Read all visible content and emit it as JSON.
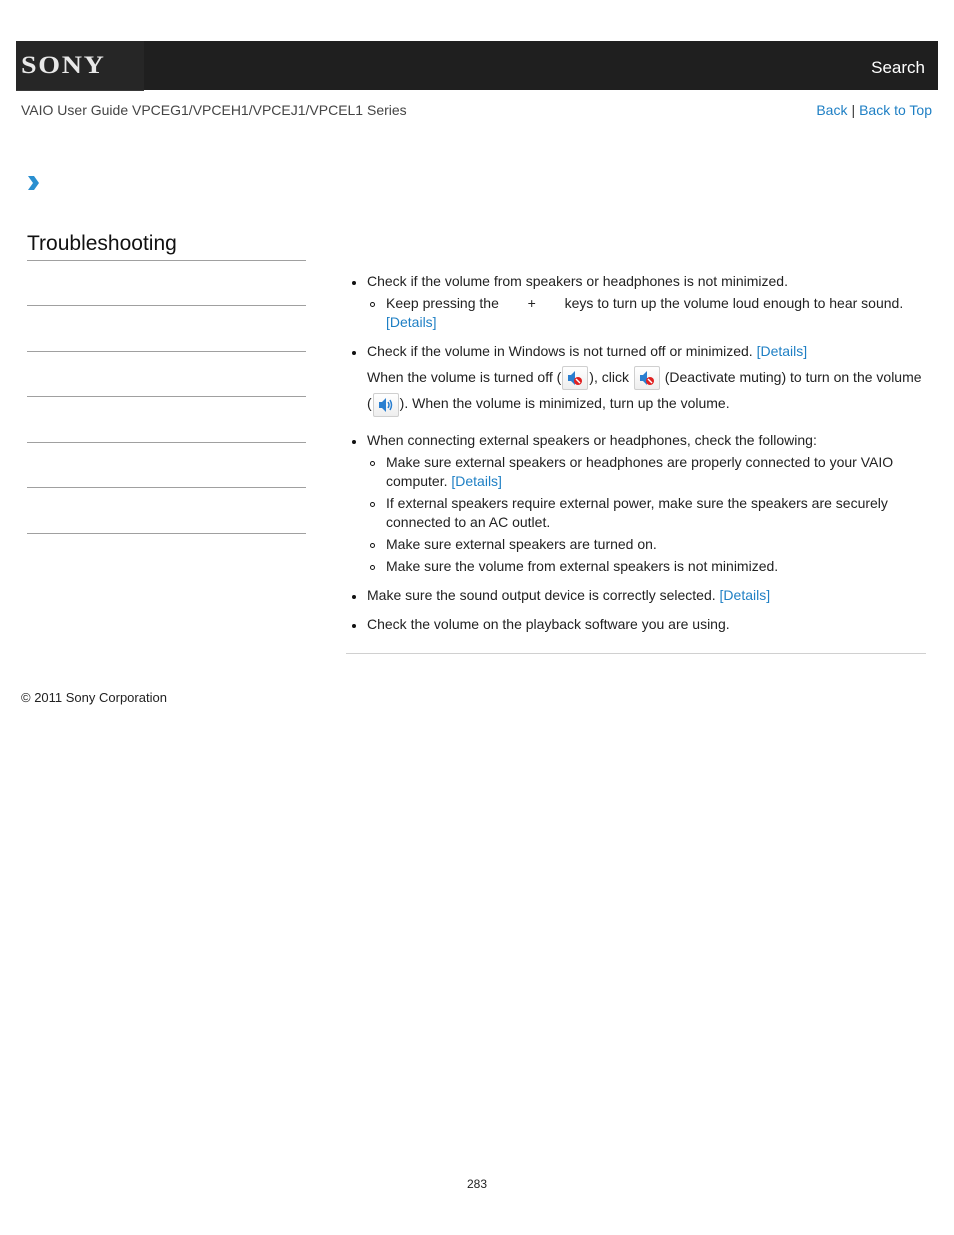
{
  "header": {
    "logo": "SONY",
    "search_label": "Search"
  },
  "subheader": {
    "guide_title": "VAIO User Guide VPCEG1/VPCEH1/VPCEJ1/VPCEL1 Series",
    "back_label": "Back",
    "separator": "|",
    "back_to_top_label": "Back to Top"
  },
  "breadcrumb": {
    "icon": "chevron-right-icon"
  },
  "sidebar": {
    "title": "Troubleshooting",
    "items": [
      "",
      "",
      "",
      "",
      "",
      ""
    ]
  },
  "content": {
    "items": [
      {
        "text": "Check if the volume from speakers or headphones is not minimized.",
        "sub": [
          {
            "text_before": "Keep pressing the",
            "plus": "+",
            "text_after": "keys to turn up the volume loud enough to hear sound.",
            "link": "[Details]"
          }
        ]
      },
      {
        "text": "Check if the volume in Windows is not turned off or minimized.",
        "link": "[Details]",
        "para_part1": "When the volume is turned off (",
        "para_part2": "), click",
        "para_part3": "(Deactivate muting) to turn on the volume",
        "para_part4": "(",
        "para_part5": "). When the volume is minimized, turn up the volume.",
        "icons": [
          "speaker-muted-icon",
          "speaker-muted-icon",
          "speaker-on-icon"
        ]
      },
      {
        "text": "When connecting external speakers or headphones, check the following:",
        "sub": [
          {
            "text": "Make sure external speakers or headphones are properly connected to your VAIO computer.",
            "link": "[Details]"
          },
          {
            "text": "If external speakers require external power, make sure the speakers are securely connected to an AC outlet."
          },
          {
            "text": "Make sure external speakers are turned on."
          },
          {
            "text": "Make sure the volume from external speakers is not minimized."
          }
        ]
      },
      {
        "text": "Make sure the sound output device is correctly selected.",
        "link": "[Details]"
      },
      {
        "text": "Check the volume on the playback software you are using."
      }
    ]
  },
  "footer": {
    "copyright": "© 2011 Sony Corporation",
    "page_number": "283"
  },
  "colors": {
    "header_bg": "#1f1f1f",
    "link": "#1e7fc4",
    "arrow": "#2a8fd0"
  }
}
